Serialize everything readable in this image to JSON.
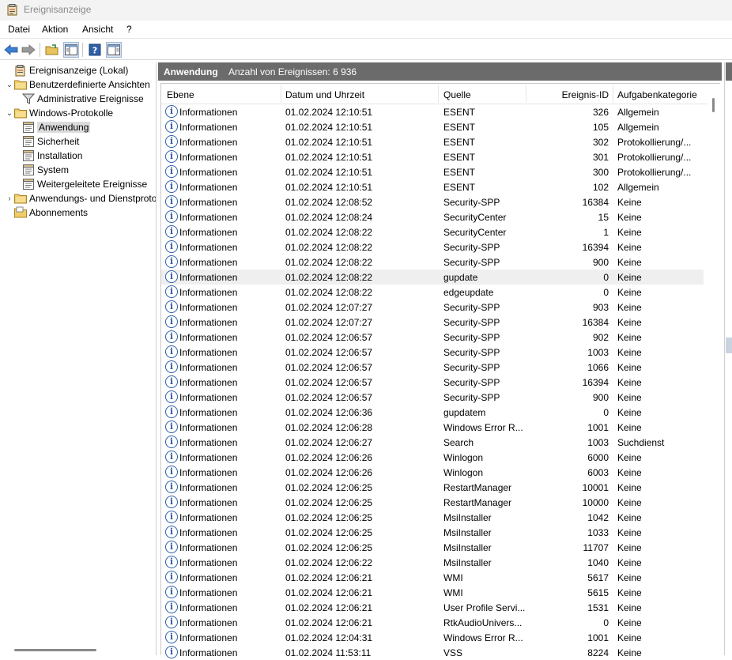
{
  "window": {
    "title": "Ereignisanzeige"
  },
  "menu": [
    "Datei",
    "Aktion",
    "Ansicht",
    "?"
  ],
  "toolbar": [
    {
      "name": "back-icon"
    },
    {
      "name": "forward-icon"
    },
    {
      "name": "open-folder-icon"
    },
    {
      "name": "show-hide-tree-icon"
    },
    {
      "name": "help-icon"
    },
    {
      "name": "show-hide-action-pane-icon"
    }
  ],
  "tree": [
    {
      "label": "Ereignisanzeige (Lokal)",
      "depth": 0,
      "chevron": "",
      "icon": "event-viewer-icon",
      "selected": false
    },
    {
      "label": "Benutzerdefinierte Ansichten",
      "depth": 0,
      "chevron": "⌄",
      "icon": "folder-icon",
      "selected": false
    },
    {
      "label": "Administrative Ereignisse",
      "depth": 1,
      "chevron": "",
      "icon": "filter-icon",
      "selected": false
    },
    {
      "label": "Windows-Protokolle",
      "depth": 0,
      "chevron": "⌄",
      "icon": "folder-icon",
      "selected": false
    },
    {
      "label": "Anwendung",
      "depth": 1,
      "chevron": "",
      "icon": "log-icon",
      "selected": true
    },
    {
      "label": "Sicherheit",
      "depth": 1,
      "chevron": "",
      "icon": "log-icon",
      "selected": false
    },
    {
      "label": "Installation",
      "depth": 1,
      "chevron": "",
      "icon": "log-icon",
      "selected": false
    },
    {
      "label": "System",
      "depth": 1,
      "chevron": "",
      "icon": "log-icon",
      "selected": false
    },
    {
      "label": "Weitergeleitete Ereignisse",
      "depth": 1,
      "chevron": "",
      "icon": "log-icon",
      "selected": false
    },
    {
      "label": "Anwendungs- und Dienstprotokolle",
      "depth": 0,
      "chevron": "›",
      "icon": "folder-icon",
      "selected": false
    },
    {
      "label": "Abonnements",
      "depth": 0,
      "chevron": "",
      "icon": "subscriptions-icon",
      "selected": false
    }
  ],
  "panel": {
    "title": "Anwendung",
    "count": "Anzahl von Ereignissen: 6 936"
  },
  "columns": [
    "Ebene",
    "Datum und Uhrzeit",
    "Quelle",
    "Ereignis-ID",
    "Aufgabenkategorie"
  ],
  "highlighted_row": 11,
  "events": [
    [
      "Informationen",
      "01.02.2024 12:10:51",
      "ESENT",
      "326",
      "Allgemein"
    ],
    [
      "Informationen",
      "01.02.2024 12:10:51",
      "ESENT",
      "105",
      "Allgemein"
    ],
    [
      "Informationen",
      "01.02.2024 12:10:51",
      "ESENT",
      "302",
      "Protokollierung/..."
    ],
    [
      "Informationen",
      "01.02.2024 12:10:51",
      "ESENT",
      "301",
      "Protokollierung/..."
    ],
    [
      "Informationen",
      "01.02.2024 12:10:51",
      "ESENT",
      "300",
      "Protokollierung/..."
    ],
    [
      "Informationen",
      "01.02.2024 12:10:51",
      "ESENT",
      "102",
      "Allgemein"
    ],
    [
      "Informationen",
      "01.02.2024 12:08:52",
      "Security-SPP",
      "16384",
      "Keine"
    ],
    [
      "Informationen",
      "01.02.2024 12:08:24",
      "SecurityCenter",
      "15",
      "Keine"
    ],
    [
      "Informationen",
      "01.02.2024 12:08:22",
      "SecurityCenter",
      "1",
      "Keine"
    ],
    [
      "Informationen",
      "01.02.2024 12:08:22",
      "Security-SPP",
      "16394",
      "Keine"
    ],
    [
      "Informationen",
      "01.02.2024 12:08:22",
      "Security-SPP",
      "900",
      "Keine"
    ],
    [
      "Informationen",
      "01.02.2024 12:08:22",
      "gupdate",
      "0",
      "Keine"
    ],
    [
      "Informationen",
      "01.02.2024 12:08:22",
      "edgeupdate",
      "0",
      "Keine"
    ],
    [
      "Informationen",
      "01.02.2024 12:07:27",
      "Security-SPP",
      "903",
      "Keine"
    ],
    [
      "Informationen",
      "01.02.2024 12:07:27",
      "Security-SPP",
      "16384",
      "Keine"
    ],
    [
      "Informationen",
      "01.02.2024 12:06:57",
      "Security-SPP",
      "902",
      "Keine"
    ],
    [
      "Informationen",
      "01.02.2024 12:06:57",
      "Security-SPP",
      "1003",
      "Keine"
    ],
    [
      "Informationen",
      "01.02.2024 12:06:57",
      "Security-SPP",
      "1066",
      "Keine"
    ],
    [
      "Informationen",
      "01.02.2024 12:06:57",
      "Security-SPP",
      "16394",
      "Keine"
    ],
    [
      "Informationen",
      "01.02.2024 12:06:57",
      "Security-SPP",
      "900",
      "Keine"
    ],
    [
      "Informationen",
      "01.02.2024 12:06:36",
      "gupdatem",
      "0",
      "Keine"
    ],
    [
      "Informationen",
      "01.02.2024 12:06:28",
      "Windows Error R...",
      "1001",
      "Keine"
    ],
    [
      "Informationen",
      "01.02.2024 12:06:27",
      "Search",
      "1003",
      "Suchdienst"
    ],
    [
      "Informationen",
      "01.02.2024 12:06:26",
      "Winlogon",
      "6000",
      "Keine"
    ],
    [
      "Informationen",
      "01.02.2024 12:06:26",
      "Winlogon",
      "6003",
      "Keine"
    ],
    [
      "Informationen",
      "01.02.2024 12:06:25",
      "RestartManager",
      "10001",
      "Keine"
    ],
    [
      "Informationen",
      "01.02.2024 12:06:25",
      "RestartManager",
      "10000",
      "Keine"
    ],
    [
      "Informationen",
      "01.02.2024 12:06:25",
      "MsiInstaller",
      "1042",
      "Keine"
    ],
    [
      "Informationen",
      "01.02.2024 12:06:25",
      "MsiInstaller",
      "1033",
      "Keine"
    ],
    [
      "Informationen",
      "01.02.2024 12:06:25",
      "MsiInstaller",
      "11707",
      "Keine"
    ],
    [
      "Informationen",
      "01.02.2024 12:06:22",
      "MsiInstaller",
      "1040",
      "Keine"
    ],
    [
      "Informationen",
      "01.02.2024 12:06:21",
      "WMI",
      "5617",
      "Keine"
    ],
    [
      "Informationen",
      "01.02.2024 12:06:21",
      "WMI",
      "5615",
      "Keine"
    ],
    [
      "Informationen",
      "01.02.2024 12:06:21",
      "User Profile Servi...",
      "1531",
      "Keine"
    ],
    [
      "Informationen",
      "01.02.2024 12:06:21",
      "RtkAudioUnivers...",
      "0",
      "Keine"
    ],
    [
      "Informationen",
      "01.02.2024 12:04:31",
      "Windows Error R...",
      "1001",
      "Keine"
    ],
    [
      "Informationen",
      "01.02.2024 11:53:11",
      "VSS",
      "8224",
      "Keine"
    ]
  ]
}
